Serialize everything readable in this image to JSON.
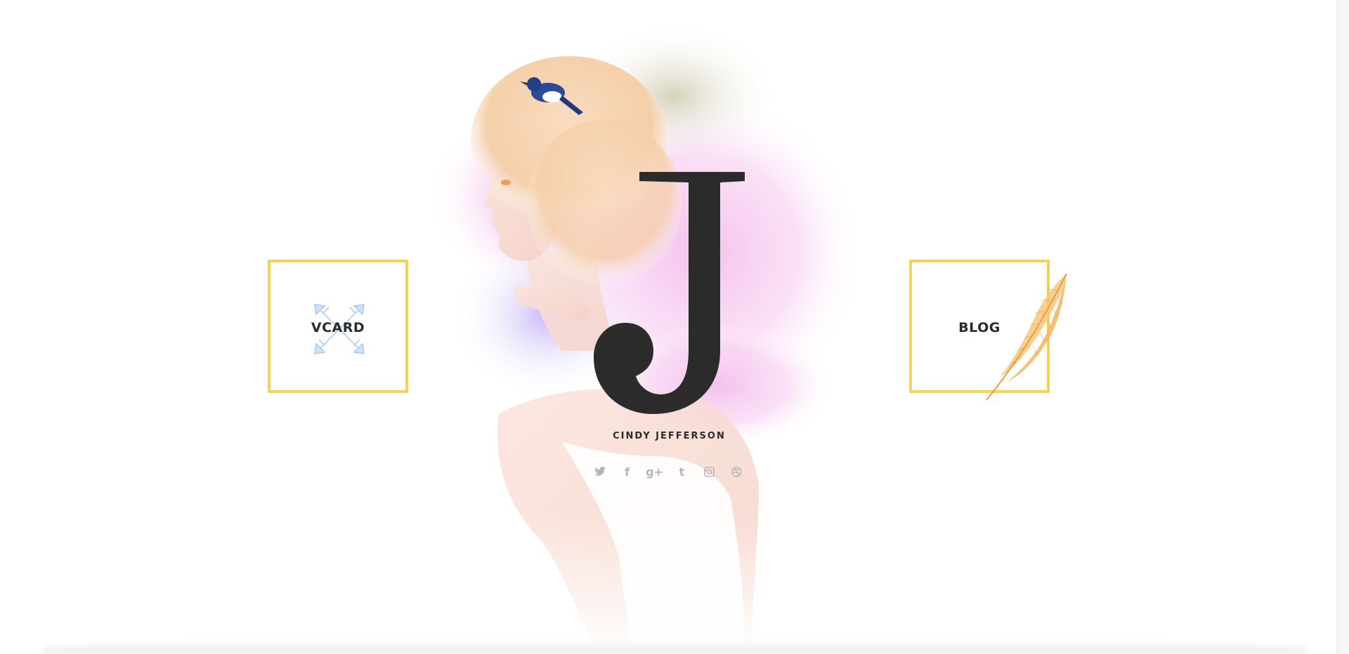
{
  "hero": {
    "monogram": "J",
    "name": "CINDY JEFFERSON"
  },
  "nav": {
    "vcard_label": "VCARD",
    "blog_label": "BLOG"
  },
  "social": [
    {
      "icon": "twitter-icon",
      "glyph": ""
    },
    {
      "icon": "facebook-icon",
      "glyph": "f"
    },
    {
      "icon": "google-plus-icon",
      "glyph": "g+"
    },
    {
      "icon": "tumblr-icon",
      "glyph": "t"
    },
    {
      "icon": "instagram-icon",
      "glyph": ""
    },
    {
      "icon": "dribbble-icon",
      "glyph": ""
    }
  ],
  "colors": {
    "accent_border": "#f0d454",
    "text_dark": "#2b2b2b",
    "social_grey": "#b9b4b4"
  }
}
